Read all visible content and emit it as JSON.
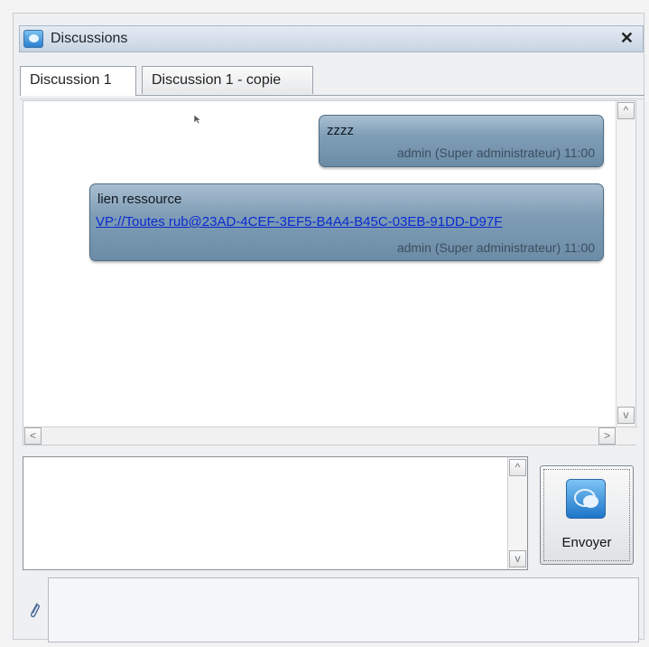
{
  "window": {
    "title": "Discussions",
    "close_label": "✕"
  },
  "tabs": [
    {
      "label": "Discussion 1",
      "active": true
    },
    {
      "label": "Discussion 1 - copie",
      "active": false
    }
  ],
  "messages": [
    {
      "text": "zzzz",
      "meta": "admin (Super administrateur) 11:00"
    },
    {
      "text": "lien ressource",
      "link": "VP://Toutes rub@23AD-4CEF-3EF5-B4A4-B45C-03EB-91DD-D97F",
      "meta": "admin (Super administrateur) 11:00"
    }
  ],
  "scroll": {
    "up": "^",
    "down": "v",
    "left": "<",
    "right": ">"
  },
  "composer": {
    "value": "",
    "send_label": "Envoyer"
  },
  "colors": {
    "bubble": "#7f9db6",
    "link": "#0a2bcf",
    "titlebar": "#c9d4e2"
  }
}
